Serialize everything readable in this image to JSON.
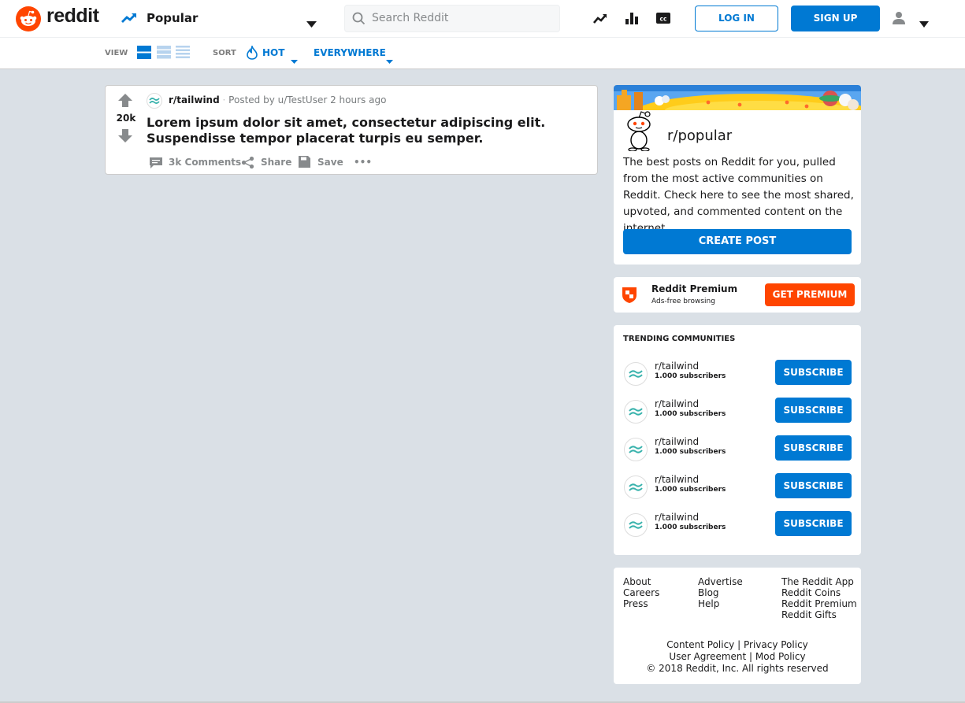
{
  "header": {
    "logo_text": "reddit",
    "feed_label": "Popular",
    "search_placeholder": "Search Reddit",
    "login_label": "LOG IN",
    "signup_label": "SIGN UP",
    "icons": [
      "trending-icon",
      "stats-icon",
      "cc-icon",
      "user-icon"
    ]
  },
  "subbar": {
    "view_label": "VIEW",
    "sort_label": "SORT",
    "sort_value": "HOT",
    "location_value": "EVERYWHERE"
  },
  "post": {
    "votes": "20k",
    "subreddit": "r/tailwind",
    "posted_by": "Posted by u/TestUser",
    "time": "2 hours ago",
    "title": "Lorem ipsum dolor sit amet, consectetur adipiscing elit. Suspendisse tempor placerat turpis eu semper.",
    "comments": "3k Comments",
    "share": "Share",
    "save": "Save",
    "more": "•••"
  },
  "popular_card": {
    "title": "r/popular",
    "description": "The best posts on Reddit for you, pulled from the most active communities on Reddit. Check here to see the most shared, upvoted, and commented content on the internet.",
    "button": "CREATE POST"
  },
  "premium_card": {
    "title": "Reddit Premium",
    "subtitle": "Ads-free browsing",
    "button": "GET PREMIUM"
  },
  "trending": {
    "title": "TRENDING COMMUNITIES",
    "items": [
      {
        "name": "r/tailwind",
        "subs": "1.000 subscribers",
        "button": "SUBSCRIBE"
      },
      {
        "name": "r/tailwind",
        "subs": "1.000 subscribers",
        "button": "SUBSCRIBE"
      },
      {
        "name": "r/tailwind",
        "subs": "1.000 subscribers",
        "button": "SUBSCRIBE"
      },
      {
        "name": "r/tailwind",
        "subs": "1.000 subscribers",
        "button": "SUBSCRIBE"
      },
      {
        "name": "r/tailwind",
        "subs": "1.000 subscribers",
        "button": "SUBSCRIBE"
      }
    ]
  },
  "footer": {
    "col1": [
      "About",
      "Careers",
      "Press"
    ],
    "col2": [
      "Advertise",
      "Blog",
      "Help"
    ],
    "col3": [
      "The Reddit App",
      "Reddit Coins",
      "Reddit Premium",
      "Reddit Gifts"
    ],
    "content_policy": "Content Policy",
    "privacy_policy": "Privacy Policy",
    "user_agreement": "User Agreement",
    "mod_policy": "Mod Policy",
    "separator": "|",
    "copyright": "© 2018 Reddit, Inc. All rights reserved"
  },
  "colors": {
    "accent": "#0079d3",
    "brand": "#ff4500",
    "background": "#dae0e6"
  }
}
